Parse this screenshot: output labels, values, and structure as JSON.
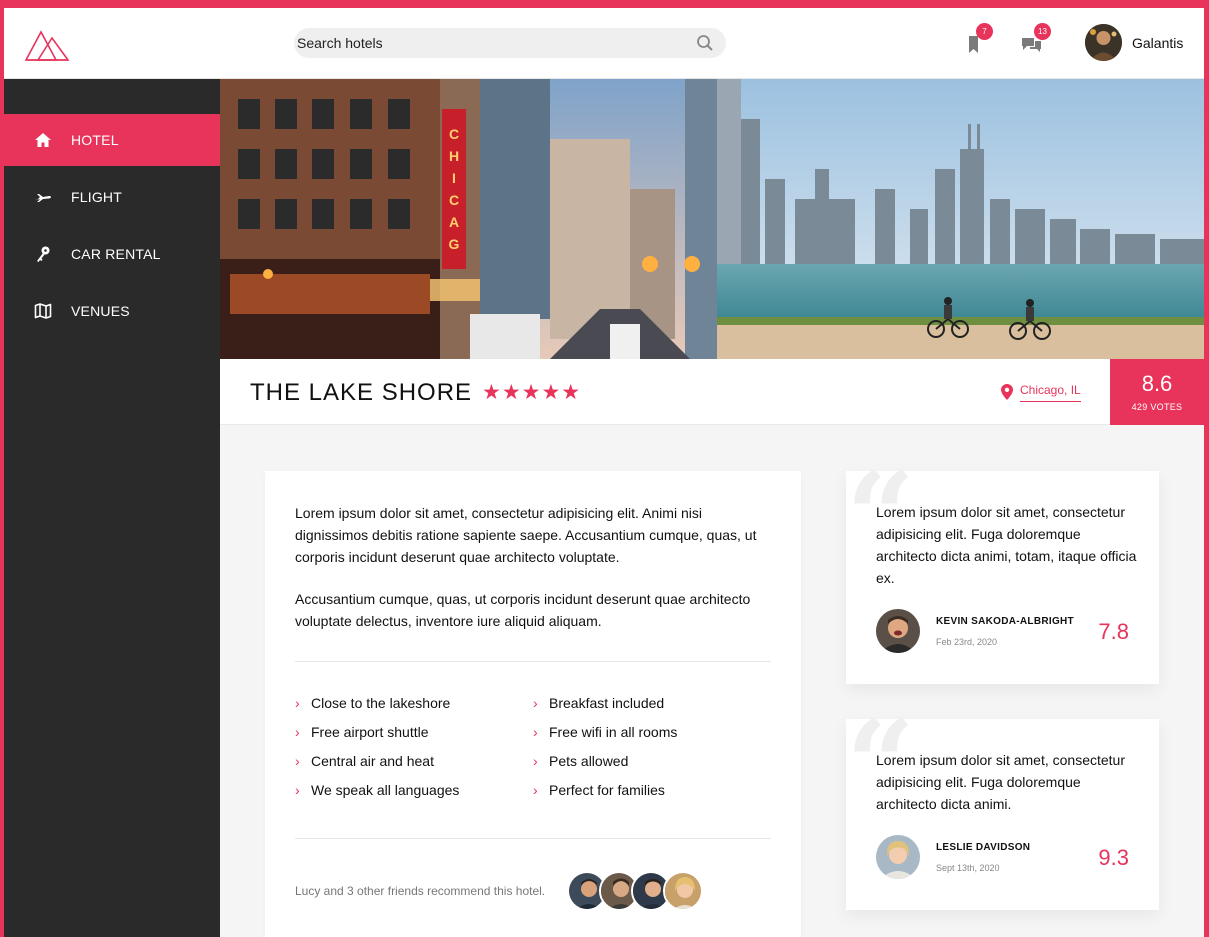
{
  "header": {
    "search_placeholder": "Search hotels",
    "bookmarks_badge": "7",
    "messages_badge": "13",
    "username": "Galantis"
  },
  "sidebar": {
    "items": [
      {
        "label": "HOTEL",
        "icon": "home-icon",
        "active": true
      },
      {
        "label": "FLIGHT",
        "icon": "plane-icon",
        "active": false
      },
      {
        "label": "CAR RENTAL",
        "icon": "key-icon",
        "active": false
      },
      {
        "label": "VENUES",
        "icon": "map-icon",
        "active": false
      }
    ]
  },
  "hotel": {
    "name": "THE LAKE SHORE",
    "stars": "★★★★★",
    "location": "Chicago, IL",
    "score": "8.6",
    "votes": "429 VOTES"
  },
  "description": {
    "paragraph1": "Lorem ipsum dolor sit amet, consectetur adipisicing elit. Animi nisi dignissimos debitis ratione sapiente saepe. Accusantium cumque, quas, ut corporis incidunt deserunt quae architecto voluptate.",
    "paragraph2": "Accusantium cumque, quas, ut corporis incidunt deserunt quae architecto voluptate delectus, inventore iure aliquid aliquam.",
    "features_left": [
      "Close to the lakeshore",
      "Free airport shuttle",
      "Central air and heat",
      "We speak all languages"
    ],
    "features_right": [
      "Breakfast included",
      "Free wifi in all rooms",
      "Pets allowed",
      "Perfect for families"
    ],
    "friends_text": "Lucy and 3 other friends recommend this hotel."
  },
  "reviews": [
    {
      "text": "Lorem ipsum dolor sit amet, consectetur adipisicing elit. Fuga doloremque architecto dicta animi, totam, itaque officia ex.",
      "name": "KEVIN SAKODA-ALBRIGHT",
      "date": "Feb 23rd, 2020",
      "score": "7.8"
    },
    {
      "text": "Lorem ipsum dolor sit amet, consectetur adipisicing elit. Fuga doloremque architecto dicta animi.",
      "name": "LESLIE DAVIDSON",
      "date": "Sept 13th, 2020",
      "score": "9.3"
    }
  ],
  "colors": {
    "accent": "#e8335b",
    "sidebar": "#2a2a2a"
  }
}
